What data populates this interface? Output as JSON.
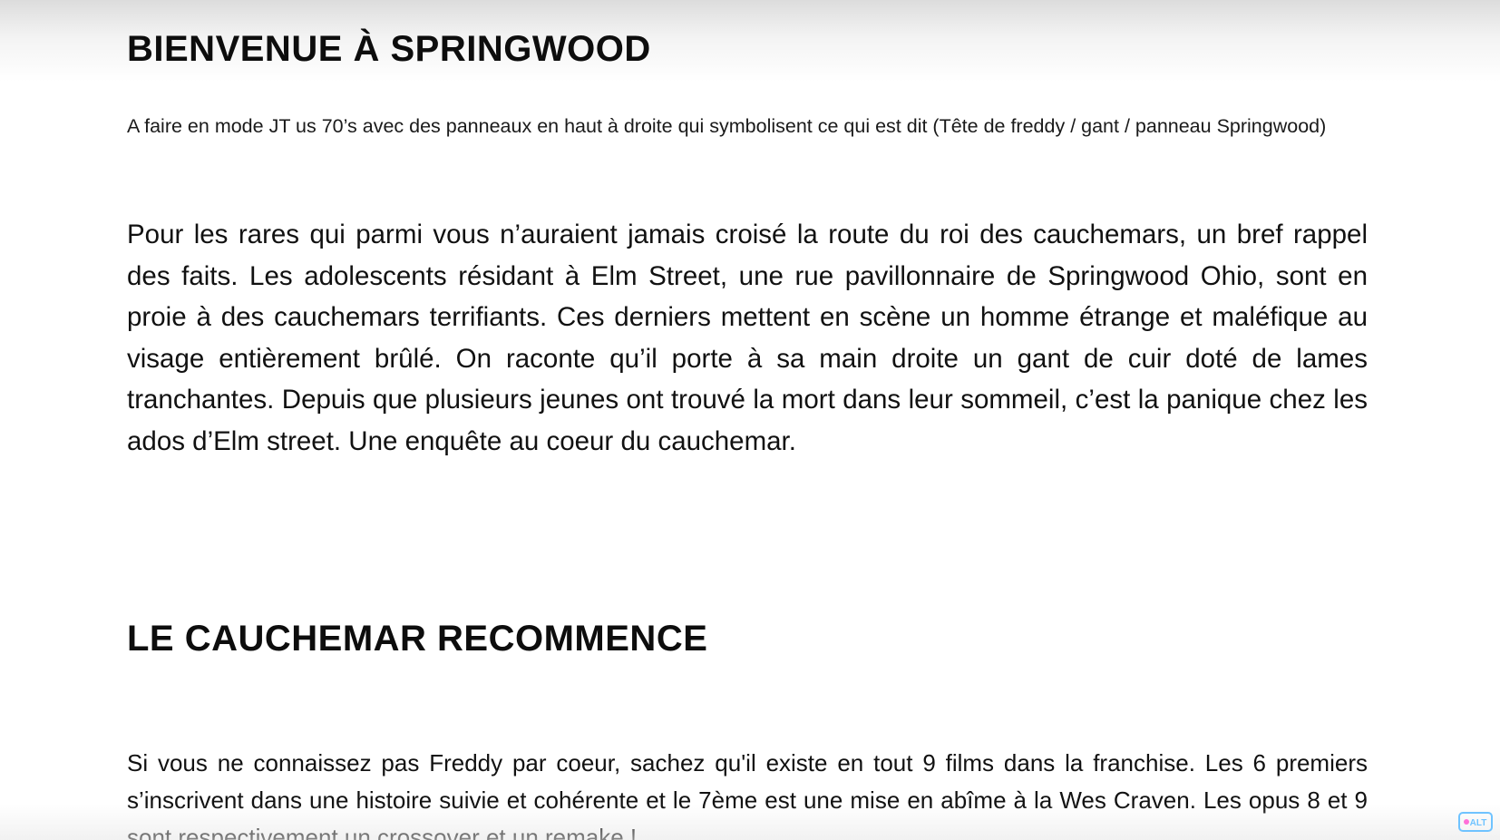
{
  "document": {
    "heading_1": "BIENVENUE À SPRINGWOOD",
    "note": "A faire en mode JT us 70’s avec des panneaux en haut à droite qui symbolisent ce qui est dit (Tête de freddy / gant / panneau Springwood)",
    "paragraph_1": "Pour les rares qui parmi vous n’auraient jamais croisé la route du roi des cauchemars, un bref rappel des faits. Les adolescents résidant à Elm Street, une rue pavillonnaire de Springwood Ohio, sont en proie à des cauchemars terrifiants. Ces derniers mettent en scène un homme étrange et maléfique au visage entièrement brûlé. On raconte qu’il porte à sa main droite un gant de cuir doté de lames tranchantes. Depuis que plusieurs jeunes ont trouvé la mort dans leur sommeil, c’est la panique chez les ados d’Elm street. Une enquête au coeur du cauchemar.",
    "heading_2": "LE CAUCHEMAR RECOMMENCE",
    "paragraph_2": "Si vous ne connaissez pas Freddy par coeur, sachez qu'il existe en tout 9 films dans la franchise. Les 6 premiers s’inscrivent dans une histoire suivie et cohérente et le 7ème est une mise en abîme à la Wes Craven. Les opus 8 et 9 sont respectivement un crossover et un remake !"
  },
  "overlay": {
    "logo_icon": "channel-logo-icon",
    "logo_text": "ALT",
    "logo_color": "#6fc3ff",
    "logo_accent": "#ff6fd8"
  }
}
